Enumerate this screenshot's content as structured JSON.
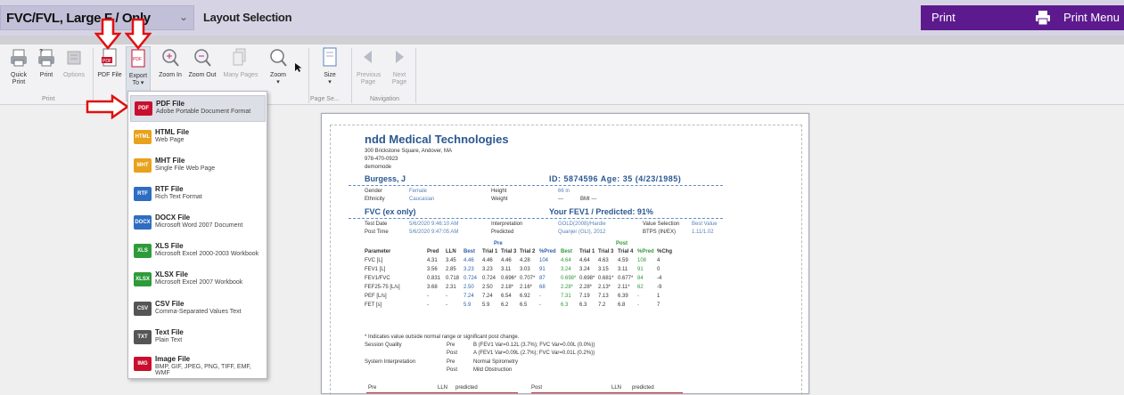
{
  "topbar": {
    "layout_value": "FVC/FVL, Large F / Only",
    "layout_label": "Layout Selection",
    "print_label": "Print",
    "print_menu_label": "Print Menu"
  },
  "ribbon": {
    "quick_print": [
      "Quick",
      "Print"
    ],
    "print": "Print",
    "options": "Options",
    "pdf_file": "PDF File",
    "export_to": [
      "Export",
      "To ▾"
    ],
    "zoom_in": "Zoom In",
    "zoom_out": "Zoom Out",
    "many_pages": "Many Pages",
    "zoom": [
      "Zoom",
      "▾"
    ],
    "size": [
      "Size",
      "▾"
    ],
    "previous_page": [
      "Previous",
      "Page"
    ],
    "next_page": [
      "Next",
      "Page"
    ],
    "group_print": "Print",
    "group_page_setup": "Page Se...",
    "group_navigation": "Navigation"
  },
  "export_menu": [
    {
      "icon": "PDF",
      "color": "#c8102e",
      "title": "PDF File",
      "desc": "Adobe Portable Document Format"
    },
    {
      "icon": "HTML",
      "color": "#e8a21c",
      "title": "HTML File",
      "desc": "Web Page"
    },
    {
      "icon": "MHT",
      "color": "#e8a21c",
      "title": "MHT File",
      "desc": "Single File Web Page"
    },
    {
      "icon": "RTF",
      "color": "#2e6dc2",
      "title": "RTF File",
      "desc": "Rich Text Format"
    },
    {
      "icon": "DOCX",
      "color": "#2e6dc2",
      "title": "DOCX File",
      "desc": "Microsoft Word 2007 Document"
    },
    {
      "icon": "XLS",
      "color": "#2e9b3a",
      "title": "XLS File",
      "desc": "Microsoft Excel 2000-2003 Workbook"
    },
    {
      "icon": "XLSX",
      "color": "#2e9b3a",
      "title": "XLSX File",
      "desc": "Microsoft Excel 2007 Workbook"
    },
    {
      "icon": "CSV",
      "color": "#555555",
      "title": "CSV File",
      "desc": "Comma-Separated Values Text"
    },
    {
      "icon": "TXT",
      "color": "#555555",
      "title": "Text File",
      "desc": "Plain Text"
    },
    {
      "icon": "IMG",
      "color": "#c8102e",
      "title": "Image File",
      "desc": "BMP, GIF, JPEG, PNG, TIFF, EMF, WMF"
    }
  ],
  "report": {
    "company": "ndd Medical Technologies",
    "address1": "300 Brickstone Square, Andover, MA",
    "phone": "978-470-0923",
    "mode": "demomode",
    "patient": "Burgess, J",
    "id_age": "ID: 5874596   Age: 35 (4/23/1985)",
    "gender_label": "Gender",
    "gender": "Female",
    "ethnicity_label": "Ethnicity",
    "ethnicity": "Caucasian",
    "height_label": "Height",
    "height": "66 in",
    "weight_label": "Weight",
    "weight": "---",
    "bmi": "BMI  ---",
    "test_title": "FVC (ex only)",
    "fev1_pred": "Your FEV1 / Predicted: 91%",
    "test_date_label": "Test Date",
    "test_date": "5/6/2020 9:46:10 AM",
    "post_time_label": "Post Time",
    "post_time": "5/6/2020 9:47:05 AM",
    "interp_label": "Interpretation",
    "interp": "GOLD(2008)/Hardie",
    "predicted_label": "Predicted",
    "predicted": "Quanjer (GLI), 2012",
    "value_sel_label": "Value Selection",
    "value_sel": "Best Value",
    "btps_label": "BTPS (IN/EX)",
    "btps": "1.11/1.02",
    "pre_label": "Pre",
    "post_label": "Post",
    "headers": [
      "Parameter",
      "Pred",
      "LLN",
      "Best",
      "Trial 1",
      "Trial 3",
      "Trial 2",
      "%Pred",
      "Best",
      "Trial 1",
      "Trial 3",
      "Trial 4",
      "%Pred",
      "%Chg"
    ],
    "rows": [
      [
        "FVC [L]",
        "4.31",
        "3.45",
        "4.46",
        "4.46",
        "4.46",
        "4.28",
        "104",
        "4.64",
        "4.64",
        "4.63",
        "4.59",
        "108",
        "4"
      ],
      [
        "FEV1 [L]",
        "3.56",
        "2.85",
        "3.23",
        "3.23",
        "3.11",
        "3.03",
        "91",
        "3.24",
        "3.24",
        "3.15",
        "3.11",
        "91",
        "0"
      ],
      [
        "FEV1/FVC",
        "0.831",
        "0.718",
        "0.724",
        "0.724",
        "0.696*",
        "0.707*",
        "87",
        "0.698*",
        "0.698*",
        "0.681*",
        "0.677*",
        "84",
        "-4"
      ],
      [
        "FEF25-75 [L/s]",
        "3.68",
        "2.31",
        "2.50",
        "2.50",
        "2.18*",
        "2.16*",
        "68",
        "2.28*",
        "2.28*",
        "2.13*",
        "2.11*",
        "62",
        "-9"
      ],
      [
        "PEF [L/s]",
        "-",
        "-",
        "7.24",
        "7.24",
        "6.54",
        "6.92",
        "-",
        "7.31",
        "7.19",
        "7.13",
        "6.39",
        "-",
        "1"
      ],
      [
        "FET [s]",
        "-",
        "-",
        "5.9",
        "5.9",
        "6.2",
        "6.5",
        "-",
        "6.3",
        "6.3",
        "7.2",
        "6.8",
        "-",
        "7"
      ]
    ],
    "footnote": "* Indicates value outside normal range or significant post change.",
    "session_quality_label": "Session Quality",
    "sq_pre": "B (FEV1 Var=0.12L (3.7%); FVC Var=0.00L (0.0%))",
    "sq_post": "A (FEV1 Var=0.09L (2.7%); FVC Var=0.01L (0.2%))",
    "sys_interp_label": "System Interpretation",
    "si_pre": "Normal Spirometry",
    "si_post": "Mild Obstruction",
    "pre_word": "Pre",
    "post_word": "Post",
    "bottom_labels": [
      "Pre",
      "LLN",
      "predicted",
      "Post",
      "LLN",
      "predicted"
    ]
  }
}
